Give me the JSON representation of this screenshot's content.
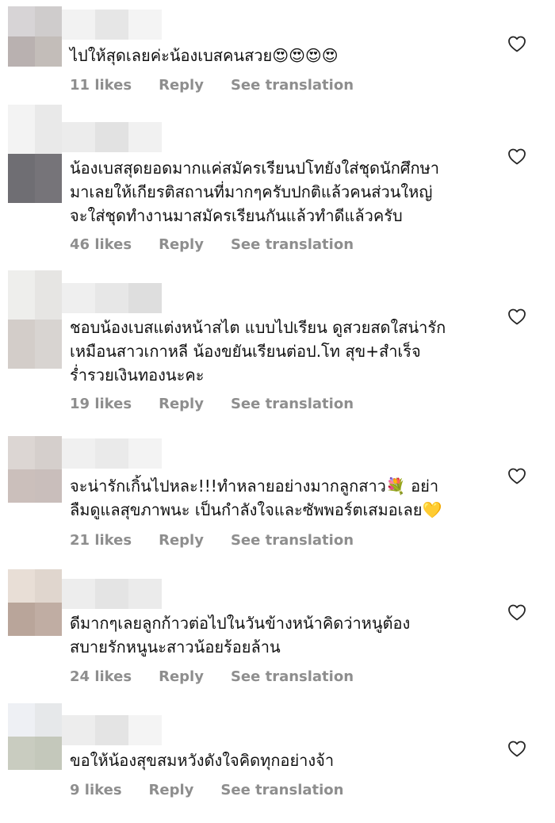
{
  "comments": [
    {
      "text": "ไปให้สุดเลยค่ะน้องเบสคนสวย😍😍😍😍",
      "likes": "11 likes",
      "reply": "Reply",
      "translate": "See translation",
      "avatar_colors": [
        "#d7d4d6",
        "#cfcccc",
        "#b9b1b0",
        "#c3bdb9"
      ],
      "username_colors": [
        "#f2f2f2",
        "#e6e6e6",
        "#f4f4f4"
      ]
    },
    {
      "text": "น้องเบสสุดยอดมากแค่สมัครเรียนปโทยังใส่ชุดนักศึกษา\nมาเลยให้เกียรติสถานที่มากๆครับปกติแล้วคนส่วนใหญ่\nจะใส่ชุดทำงานมาสมัครเรียนกันแล้วทำดีแล้วครับ",
      "likes": "46 likes",
      "reply": "Reply",
      "translate": "See translation",
      "avatar_colors": [
        "#f3f3f3",
        "#e9e9e9",
        "#6f6e73",
        "#767479"
      ],
      "username_colors": [
        "#ececec",
        "#e2e2e2",
        "#f1f1f1"
      ]
    },
    {
      "text": "ชอบน้องเบสแต่งหน้าสไต แบบไปเรียน ดูสวยสดใสน่ารัก\nเหมือนสาวเกาหลี  น้องขยันเรียนต่อป.โท สุข+สำเร็จ\nร่ำรวยเงินทองนะคะ",
      "likes": "19 likes",
      "reply": "Reply",
      "translate": "See translation",
      "avatar_colors": [
        "#eeeeec",
        "#e6e5e3",
        "#d3cdc9",
        "#d8d4d1"
      ],
      "username_colors": [
        "#efefef",
        "#e7e7e7",
        "#dedede"
      ]
    },
    {
      "text": "จะน่ารักเกิ้นไปหละ!!!ทำหลายอย่างมากลูกสาว💐 อย่า\nลืมดูแลสุขภาพนะ เป็นกำลังใจและซัพพอร์ตเสมอเลย💛",
      "likes": "21 likes",
      "reply": "Reply",
      "translate": "See translation",
      "avatar_colors": [
        "#dcd6d3",
        "#d5cfcc",
        "#cbbfbb",
        "#c9bebb"
      ],
      "username_colors": [
        "#f0f0f0",
        "#eaeaea",
        "#f3f3f3"
      ]
    },
    {
      "text": "ดีมากๆเลยลูกก้าวต่อไปในวันข้างหน้าคิดว่าหนูต้อง\nสบายรักหนูนะสาวน้อยร้อยล้าน",
      "likes": "24 likes",
      "reply": "Reply",
      "translate": "See translation",
      "avatar_colors": [
        "#e8ded6",
        "#e0d6ce",
        "#b9a59a",
        "#c0ada3"
      ],
      "username_colors": [
        "#ededed",
        "#e4e4e4",
        "#ebebeb"
      ]
    },
    {
      "text": "ขอให้น้องสุขสมหวังดังใจคิดทุกอย่างจ้า",
      "likes": "9 likes",
      "reply": "Reply",
      "translate": "See translation",
      "avatar_colors": [
        "#eef0f4",
        "#e6e8ea",
        "#c9ccc0",
        "#c4c8bb"
      ],
      "username_colors": [
        "#ededed",
        "#e4e4e4",
        "#f4f4f4"
      ]
    }
  ]
}
